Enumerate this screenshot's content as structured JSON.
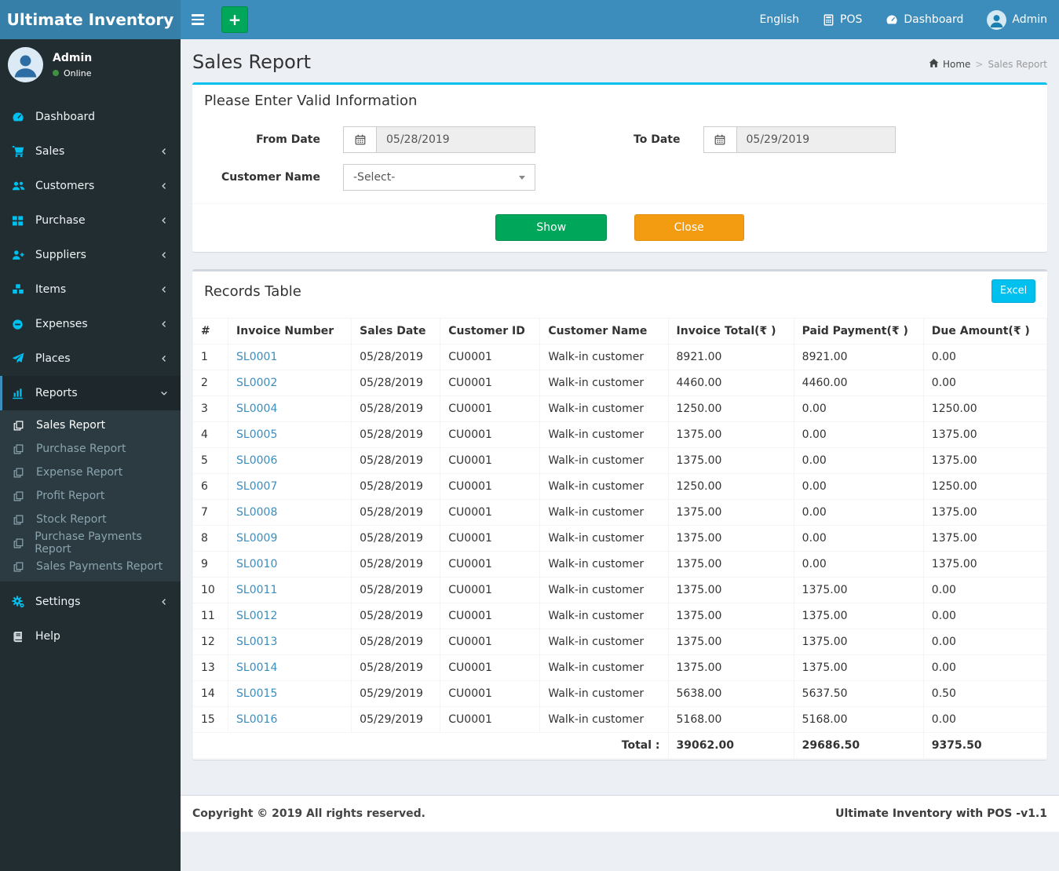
{
  "theme": {
    "navbar_bg": "#3c8dbc",
    "logo_bg": "#367fa9",
    "sidebar_bg": "#222d32",
    "submenu_bg": "#2c3b41",
    "accent_info": "#00c0ef",
    "accent_success": "#00a65a",
    "accent_warning": "#f39c12",
    "content_bg": "#ecf0f5",
    "link_color": "#3c8dbc"
  },
  "navbar": {
    "brand": "Ultimate Inventory",
    "language": "English",
    "pos_label": "POS",
    "dashboard_label": "Dashboard",
    "user_label": "Admin"
  },
  "sidebar": {
    "user": {
      "name": "Admin",
      "status": "Online"
    },
    "menu": [
      {
        "label": "Dashboard"
      },
      {
        "label": "Sales"
      },
      {
        "label": "Customers"
      },
      {
        "label": "Purchase"
      },
      {
        "label": "Suppliers"
      },
      {
        "label": "Items"
      },
      {
        "label": "Expenses"
      },
      {
        "label": "Places"
      },
      {
        "label": "Reports"
      }
    ],
    "reports_submenu": [
      {
        "label": "Sales Report"
      },
      {
        "label": "Purchase Report"
      },
      {
        "label": "Expense Report"
      },
      {
        "label": "Profit Report"
      },
      {
        "label": "Stock Report"
      },
      {
        "label": "Purchase Payments Report"
      },
      {
        "label": "Sales Payments Report"
      }
    ],
    "settings_label": "Settings",
    "help_label": "Help"
  },
  "page": {
    "title": "Sales Report",
    "breadcrumb_home": "Home",
    "breadcrumb_sep": ">",
    "breadcrumb_current": "Sales Report"
  },
  "filter": {
    "title": "Please Enter Valid Information",
    "from_date": {
      "label": "From Date",
      "value": "05/28/2019"
    },
    "to_date": {
      "label": "To Date",
      "value": "05/29/2019"
    },
    "customer": {
      "label": "Customer Name",
      "value": "-Select-"
    },
    "show_label": "Show",
    "close_label": "Close"
  },
  "records": {
    "title": "Records Table",
    "excel_label": "Excel",
    "headers": [
      "#",
      "Invoice Number",
      "Sales Date",
      "Customer ID",
      "Customer Name",
      "Invoice Total(₹ )",
      "Paid Payment(₹ )",
      "Due Amount(₹ )"
    ],
    "rows": [
      {
        "n": "1",
        "invoice": "SL0001",
        "date": "05/28/2019",
        "customer_id": "CU0001",
        "customer_name": "Walk-in customer",
        "total": "8921.00",
        "paid": "8921.00",
        "due": "0.00"
      },
      {
        "n": "2",
        "invoice": "SL0002",
        "date": "05/28/2019",
        "customer_id": "CU0001",
        "customer_name": "Walk-in customer",
        "total": "4460.00",
        "paid": "4460.00",
        "due": "0.00"
      },
      {
        "n": "3",
        "invoice": "SL0004",
        "date": "05/28/2019",
        "customer_id": "CU0001",
        "customer_name": "Walk-in customer",
        "total": "1250.00",
        "paid": "0.00",
        "due": "1250.00"
      },
      {
        "n": "4",
        "invoice": "SL0005",
        "date": "05/28/2019",
        "customer_id": "CU0001",
        "customer_name": "Walk-in customer",
        "total": "1375.00",
        "paid": "0.00",
        "due": "1375.00"
      },
      {
        "n": "5",
        "invoice": "SL0006",
        "date": "05/28/2019",
        "customer_id": "CU0001",
        "customer_name": "Walk-in customer",
        "total": "1375.00",
        "paid": "0.00",
        "due": "1375.00"
      },
      {
        "n": "6",
        "invoice": "SL0007",
        "date": "05/28/2019",
        "customer_id": "CU0001",
        "customer_name": "Walk-in customer",
        "total": "1250.00",
        "paid": "0.00",
        "due": "1250.00"
      },
      {
        "n": "7",
        "invoice": "SL0008",
        "date": "05/28/2019",
        "customer_id": "CU0001",
        "customer_name": "Walk-in customer",
        "total": "1375.00",
        "paid": "0.00",
        "due": "1375.00"
      },
      {
        "n": "8",
        "invoice": "SL0009",
        "date": "05/28/2019",
        "customer_id": "CU0001",
        "customer_name": "Walk-in customer",
        "total": "1375.00",
        "paid": "0.00",
        "due": "1375.00"
      },
      {
        "n": "9",
        "invoice": "SL0010",
        "date": "05/28/2019",
        "customer_id": "CU0001",
        "customer_name": "Walk-in customer",
        "total": "1375.00",
        "paid": "0.00",
        "due": "1375.00"
      },
      {
        "n": "10",
        "invoice": "SL0011",
        "date": "05/28/2019",
        "customer_id": "CU0001",
        "customer_name": "Walk-in customer",
        "total": "1375.00",
        "paid": "1375.00",
        "due": "0.00"
      },
      {
        "n": "11",
        "invoice": "SL0012",
        "date": "05/28/2019",
        "customer_id": "CU0001",
        "customer_name": "Walk-in customer",
        "total": "1375.00",
        "paid": "1375.00",
        "due": "0.00"
      },
      {
        "n": "12",
        "invoice": "SL0013",
        "date": "05/28/2019",
        "customer_id": "CU0001",
        "customer_name": "Walk-in customer",
        "total": "1375.00",
        "paid": "1375.00",
        "due": "0.00"
      },
      {
        "n": "13",
        "invoice": "SL0014",
        "date": "05/28/2019",
        "customer_id": "CU0001",
        "customer_name": "Walk-in customer",
        "total": "1375.00",
        "paid": "1375.00",
        "due": "0.00"
      },
      {
        "n": "14",
        "invoice": "SL0015",
        "date": "05/29/2019",
        "customer_id": "CU0001",
        "customer_name": "Walk-in customer",
        "total": "5638.00",
        "paid": "5637.50",
        "due": "0.50"
      },
      {
        "n": "15",
        "invoice": "SL0016",
        "date": "05/29/2019",
        "customer_id": "CU0001",
        "customer_name": "Walk-in customer",
        "total": "5168.00",
        "paid": "5168.00",
        "due": "0.00"
      }
    ],
    "total": {
      "label": "Total :",
      "invoice_total": "39062.00",
      "paid_payment": "29686.50",
      "due_amount": "9375.50"
    }
  },
  "footer": {
    "left": "Copyright © 2019 All rights reserved.",
    "right": "Ultimate Inventory with POS -v1.1"
  }
}
